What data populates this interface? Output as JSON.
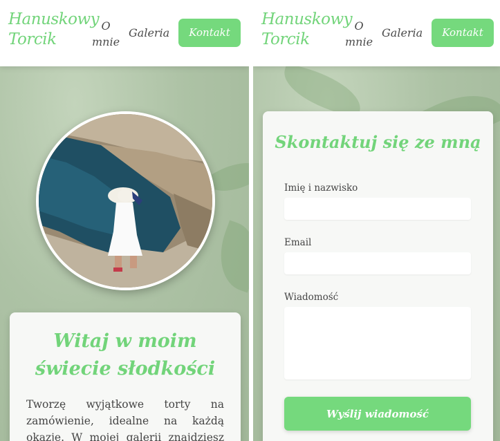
{
  "brand": {
    "logo_line1": "Hanuskowy",
    "logo_line2": "Torcik",
    "accent_color": "#75d97d"
  },
  "nav": {
    "about_line1": "O",
    "about_line2": "mnie",
    "gallery": "Galeria",
    "contact": "Kontakt"
  },
  "home": {
    "portrait_icon": "portrait-photo",
    "welcome_title": "Witaj w moim świecie słodkości",
    "welcome_text": "Tworzę wyjątkowe torty na zamówienie, idealne na każdą okazję. W mojej galerii znajdziesz przykłady"
  },
  "contact_form": {
    "title": "Skontaktuj się ze mną",
    "name_label": "Imię i nazwisko",
    "name_value": "",
    "email_label": "Email",
    "email_value": "",
    "message_label": "Wiadomość",
    "message_value": "",
    "submit": "Wyślij wiadomość"
  }
}
